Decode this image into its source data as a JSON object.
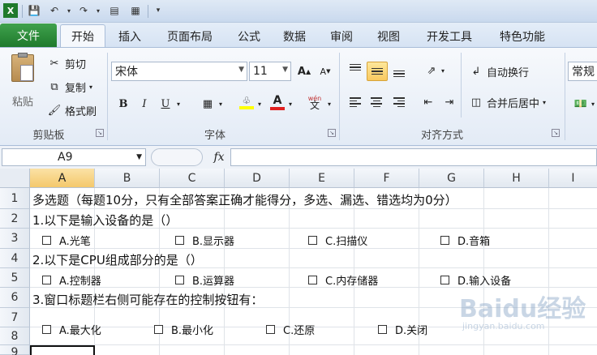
{
  "ribbon_tabs": {
    "file": "文件",
    "home": "开始",
    "insert": "插入",
    "page_layout": "页面布局",
    "formulas": "公式",
    "data": "数据",
    "review": "审阅",
    "view": "视图",
    "developer": "开发工具",
    "special": "特色功能"
  },
  "clipboard": {
    "paste": "粘贴",
    "cut": "剪切",
    "copy": "复制",
    "format_painter": "格式刷",
    "group_label": "剪贴板"
  },
  "font": {
    "name": "宋体",
    "size": "11",
    "group_label": "字体",
    "bold": "B",
    "italic": "I",
    "underline": "U",
    "font_color_letter": "A",
    "grow": "A",
    "shrink": "A",
    "phonetic": "wén"
  },
  "alignment": {
    "wrap_text": "自动换行",
    "merge_center": "合并后居中",
    "group_label": "对齐方式"
  },
  "number": {
    "format": "常规"
  },
  "formula_bar": {
    "name_box": "A9",
    "fx": "fx"
  },
  "grid": {
    "columns": [
      "A",
      "B",
      "C",
      "D",
      "E",
      "F",
      "G",
      "H",
      "I"
    ],
    "rows": [
      "1",
      "2",
      "3",
      "4",
      "5",
      "6",
      "7",
      "8",
      "9"
    ],
    "cells": {
      "r1": "多选题（每题10分，只有全部答案正确才能得分，多选、漏选、错选均为0分）",
      "r2": "1.以下是输入设备的是（）",
      "r3": [
        "A.光笔",
        "B.显示器",
        "C.扫描仪",
        "D.音箱"
      ],
      "r4": "2.以下是CPU组成部分的是（）",
      "r5": [
        "A.控制器",
        "B.运算器",
        "C.内存储器",
        "D.输入设备"
      ],
      "r6": "3.窗口标题栏右侧可能存在的控制按钮有：",
      "r7": [
        "A.最大化",
        "B.最小化",
        "C.还原",
        "D.关闭"
      ]
    }
  },
  "watermark": {
    "main": "Baidu经验",
    "sub": "jingyan.baidu.com"
  },
  "colors": {
    "file_tab": "#1f7a2c",
    "selection": "#f4c86b",
    "font_color": "#e02020",
    "highlight": "#ffff00"
  }
}
